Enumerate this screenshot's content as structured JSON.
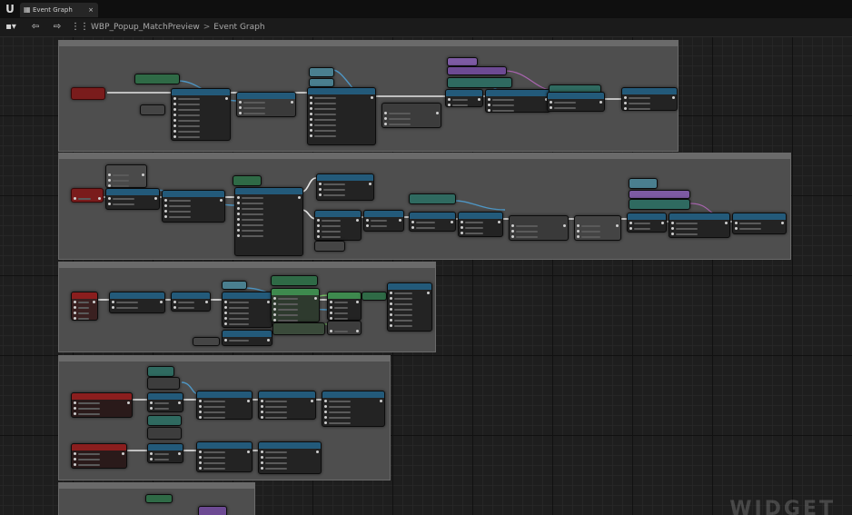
{
  "app": {
    "logo_icon": "unreal-engine-logo-icon"
  },
  "tabs": [
    {
      "label": "Event Graph",
      "icon": "graph-icon",
      "active": true
    }
  ],
  "toolbar": {
    "icons": [
      "blueprint-icon",
      "back-arrow-icon",
      "forward-arrow-icon",
      "hierarchy-icon"
    ]
  },
  "breadcrumb": {
    "items": [
      "WBP_Popup_MatchPreview",
      "Event Graph"
    ],
    "separator": ">"
  },
  "watermark": "WIDGET",
  "colors": {
    "graph_background": "#1e1e1e",
    "comment_box": "#4e4e4e",
    "event_node": "#8b1e1e",
    "function_node": "#1f4e6b",
    "variable_node": "#3e8a4e",
    "macro_node": "#7a5a9a",
    "exec_wire": "#e8e8e8"
  }
}
